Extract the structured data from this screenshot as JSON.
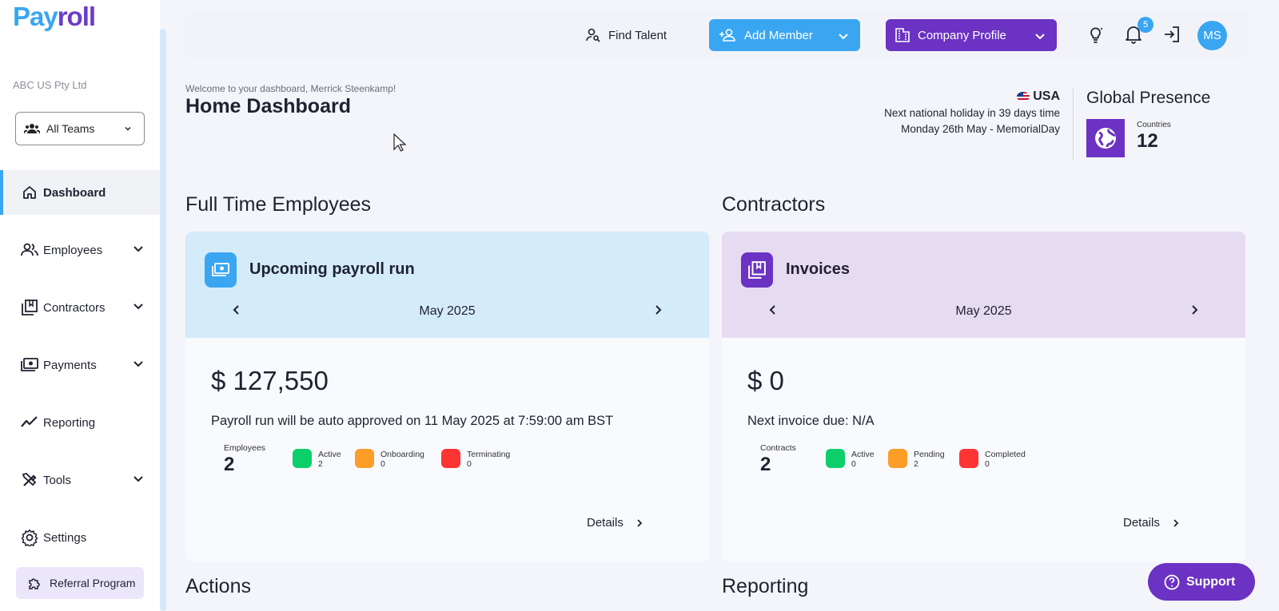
{
  "brand": {
    "logo_part1": "Pay",
    "logo_part2": "roll",
    "accent": "#3aa6f2",
    "purple": "#6b32c3"
  },
  "sidebar": {
    "company": "ABC US Pty Ltd",
    "team_selector": "All Teams",
    "items": [
      {
        "label": "Dashboard",
        "icon": "home-icon",
        "active": true
      },
      {
        "label": "Employees",
        "icon": "people-icon",
        "expandable": true
      },
      {
        "label": "Contractors",
        "icon": "contracts-icon",
        "expandable": true
      },
      {
        "label": "Payments",
        "icon": "money-icon",
        "expandable": true
      },
      {
        "label": "Reporting",
        "icon": "trend-icon"
      },
      {
        "label": "Tools",
        "icon": "tools-icon",
        "expandable": true
      },
      {
        "label": "Settings",
        "icon": "gear-icon"
      }
    ],
    "referral": "Referral Program"
  },
  "topbar": {
    "find_talent": "Find Talent",
    "add_member": "Add Member",
    "company_profile": "Company Profile",
    "notification_count": "5",
    "avatar_initials": "MS"
  },
  "header": {
    "welcome": "Welcome to your dashboard, Merrick Steenkamp!",
    "title": "Home Dashboard",
    "country": "USA",
    "holiday_line1": "Next national holiday in 39 days time",
    "holiday_line2": "Monday 26th May - MemorialDay",
    "global_title": "Global Presence",
    "countries_label": "Countries",
    "countries_value": "12"
  },
  "sections": {
    "fte": "Full Time Employees",
    "contractors": "Contractors",
    "actions": "Actions",
    "reporting": "Reporting"
  },
  "payroll_card": {
    "title": "Upcoming payroll run",
    "month": "May 2025",
    "amount": "$ 127,550",
    "note": "Payroll run will be auto approved on 11 May 2025 at 7:59:00 am BST",
    "main_label": "Employees",
    "main_value": "2",
    "stats": [
      {
        "label": "Active",
        "value": "2"
      },
      {
        "label": "Onboarding",
        "value": "0"
      },
      {
        "label": "Terminating",
        "value": "0"
      }
    ],
    "details": "Details"
  },
  "invoice_card": {
    "title": "Invoices",
    "month": "May 2025",
    "amount": "$ 0",
    "note": "Next invoice due: N/A",
    "main_label": "Contracts",
    "main_value": "2",
    "stats": [
      {
        "label": "Active",
        "value": "0"
      },
      {
        "label": "Pending",
        "value": "2"
      },
      {
        "label": "Completed",
        "value": "0"
      }
    ],
    "details": "Details"
  },
  "support": {
    "label": "Support"
  }
}
